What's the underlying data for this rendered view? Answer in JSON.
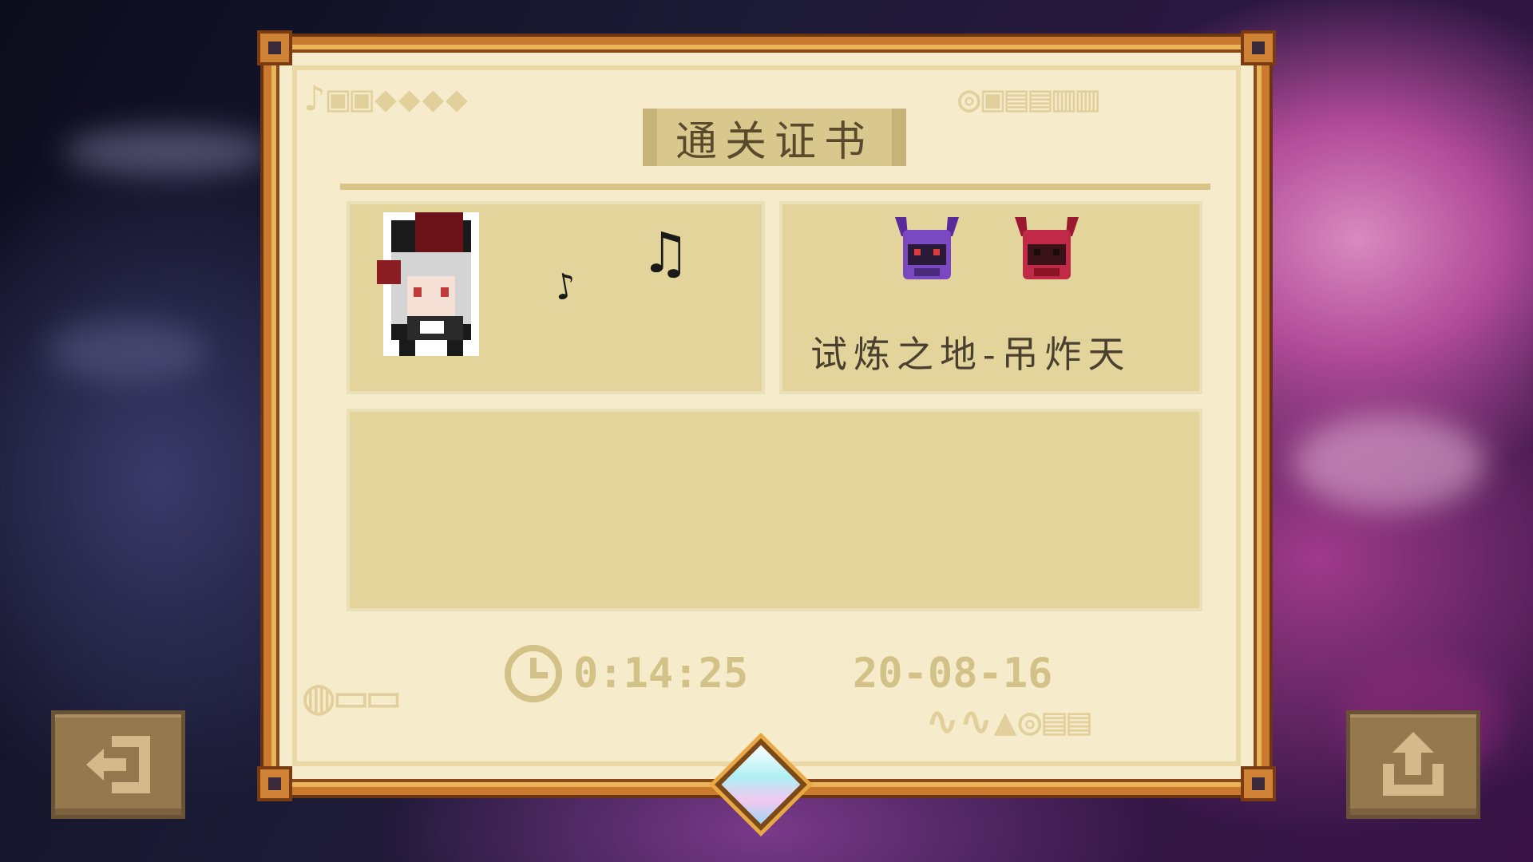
{
  "certificate": {
    "title": "通关证书",
    "stage_name": "试炼之地-吊炸天",
    "time": "0:14:25",
    "date": "20-08-16"
  },
  "icons": {
    "exit": "exit-door-icon",
    "share": "share-upload-icon",
    "clock": "clock-icon",
    "gem": "diamond-gem-icon",
    "bosses": [
      "purple-horned-helmet-icon",
      "red-horned-helmet-icon"
    ],
    "notes": [
      "eighth-note-icon",
      "beamed-notes-icon"
    ]
  },
  "colors": {
    "frame": "#c97a2e",
    "parchment": "#f6eccc",
    "panel": "#e2d49a",
    "info_text": "#d3c287",
    "button": "#96784e",
    "boss_purple": "#6a38a8",
    "boss_red": "#b0203a"
  }
}
